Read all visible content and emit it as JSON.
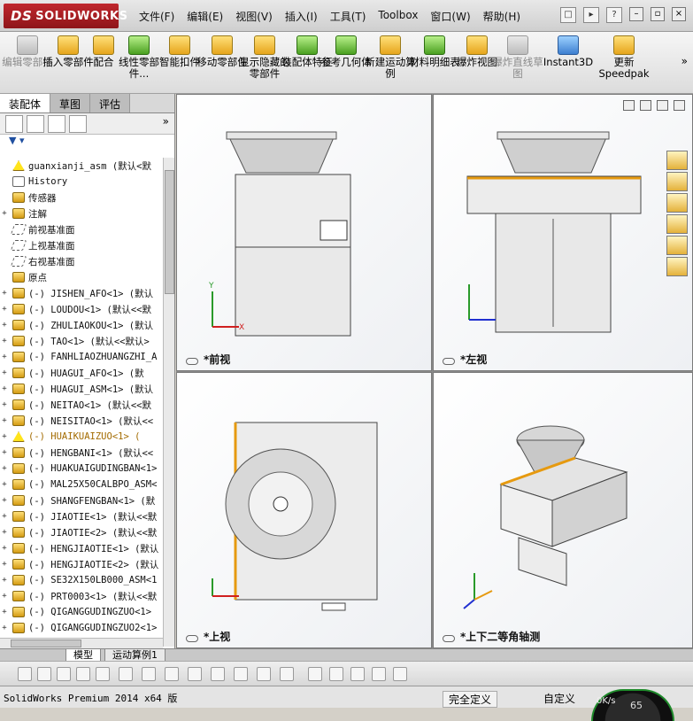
{
  "app": {
    "name": "SOLIDWORKS",
    "brand_color": "#b01e24"
  },
  "menu": {
    "items": [
      "文件(F)",
      "编辑(E)",
      "视图(V)",
      "插入(I)",
      "工具(T)",
      "Toolbox",
      "窗口(W)",
      "帮助(H)"
    ]
  },
  "commands": [
    {
      "label": "编辑零部件",
      "enabled": false
    },
    {
      "label": "插入零部件",
      "enabled": true
    },
    {
      "label": "配合",
      "enabled": true
    },
    {
      "label": "线性零部件...",
      "enabled": true
    },
    {
      "label": "智能扣件",
      "enabled": true
    },
    {
      "label": "移动零部件",
      "enabled": true
    },
    {
      "label": "显示隐藏的零部件",
      "enabled": true
    },
    {
      "label": "装配体特征",
      "enabled": true
    },
    {
      "label": "参考几何体",
      "enabled": true
    },
    {
      "label": "新建运动算例",
      "enabled": true
    },
    {
      "label": "材料明细表",
      "enabled": true
    },
    {
      "label": "爆炸视图",
      "enabled": true
    },
    {
      "label": "爆炸直线草图",
      "enabled": false
    },
    {
      "label": "Instant3D",
      "enabled": true
    },
    {
      "label": "更新Speedpak",
      "enabled": true
    }
  ],
  "panel": {
    "tabs": [
      "装配体",
      "草图",
      "评估"
    ],
    "active_tab": "装配体"
  },
  "tree": [
    {
      "label": "guanxianji_asm  (默认<默",
      "icon": "warn-assembly",
      "expand": ""
    },
    {
      "label": "History",
      "icon": "history",
      "expand": ""
    },
    {
      "label": "传感器",
      "icon": "sensor",
      "expand": ""
    },
    {
      "label": "注解",
      "icon": "annotation",
      "expand": "+"
    },
    {
      "label": "前视基准面",
      "icon": "plane",
      "expand": ""
    },
    {
      "label": "上视基准面",
      "icon": "plane",
      "expand": ""
    },
    {
      "label": "右视基准面",
      "icon": "plane",
      "expand": ""
    },
    {
      "label": "原点",
      "icon": "origin",
      "expand": ""
    },
    {
      "label": "(-) JISHEN_AFO<1> (默认",
      "icon": "part",
      "expand": "+"
    },
    {
      "label": "(-) LOUDOU<1> (默认<<默",
      "icon": "part",
      "expand": "+"
    },
    {
      "label": "(-) ZHULIAOKOU<1> (默认",
      "icon": "part",
      "expand": "+"
    },
    {
      "label": "(-) TAO<1> (默认<<默认>",
      "icon": "part",
      "expand": "+"
    },
    {
      "label": "(-) FANHLIAOZHUANGZHI_A",
      "icon": "part",
      "expand": "+"
    },
    {
      "label": "(-) HUAGUI_AFO<1> (默",
      "icon": "part",
      "expand": "+"
    },
    {
      "label": "(-) HUAGUI_ASM<1> (默认",
      "icon": "part",
      "expand": "+"
    },
    {
      "label": "(-) NEITAO<1> (默认<<默",
      "icon": "part",
      "expand": "+"
    },
    {
      "label": "(-) NEISITAO<1> (默认<<",
      "icon": "part",
      "expand": "+"
    },
    {
      "label": "(-) HUAIKUAIZUO<1> (",
      "icon": "warn",
      "expand": "+"
    },
    {
      "label": "(-) HENGBANI<1> (默认<<",
      "icon": "part",
      "expand": "+"
    },
    {
      "label": "(-) HUAKUAIGUDINGBAN<1>",
      "icon": "part",
      "expand": "+"
    },
    {
      "label": "(-) MAL25X50CALBPO_ASM<",
      "icon": "part",
      "expand": "+"
    },
    {
      "label": "(-) SHANGFENGBAN<1> (默",
      "icon": "part",
      "expand": "+"
    },
    {
      "label": "(-) JIAOTIE<1> (默认<<默",
      "icon": "part",
      "expand": "+"
    },
    {
      "label": "(-) JIAOTIE<2> (默认<<默",
      "icon": "part",
      "expand": "+"
    },
    {
      "label": "(-) HENGJIAOTIE<1> (默认",
      "icon": "part",
      "expand": "+"
    },
    {
      "label": "(-) HENGJIAOTIE<2> (默认",
      "icon": "part",
      "expand": "+"
    },
    {
      "label": "(-) SE32X150LB000_ASM<1",
      "icon": "part",
      "expand": "+"
    },
    {
      "label": "(-) PRT0003<1> (默认<<默",
      "icon": "part",
      "expand": "+"
    },
    {
      "label": "(-) QIGANGGUDINGZUO<1>",
      "icon": "part",
      "expand": "+"
    },
    {
      "label": "(-) QIGANGGUDINGZUO2<1>",
      "icon": "part",
      "expand": "+"
    }
  ],
  "viewports": [
    {
      "label": "*前视"
    },
    {
      "label": "*左视"
    },
    {
      "label": "*上视"
    },
    {
      "label": "*上下二等角轴测"
    }
  ],
  "bottom_tabs": [
    "模型",
    "运动算例1"
  ],
  "status": {
    "version": "SolidWorks Premium 2014 x64 版",
    "state": "完全定义",
    "mode": "自定义",
    "speed": "0K/s",
    "gauge_value": "65"
  }
}
